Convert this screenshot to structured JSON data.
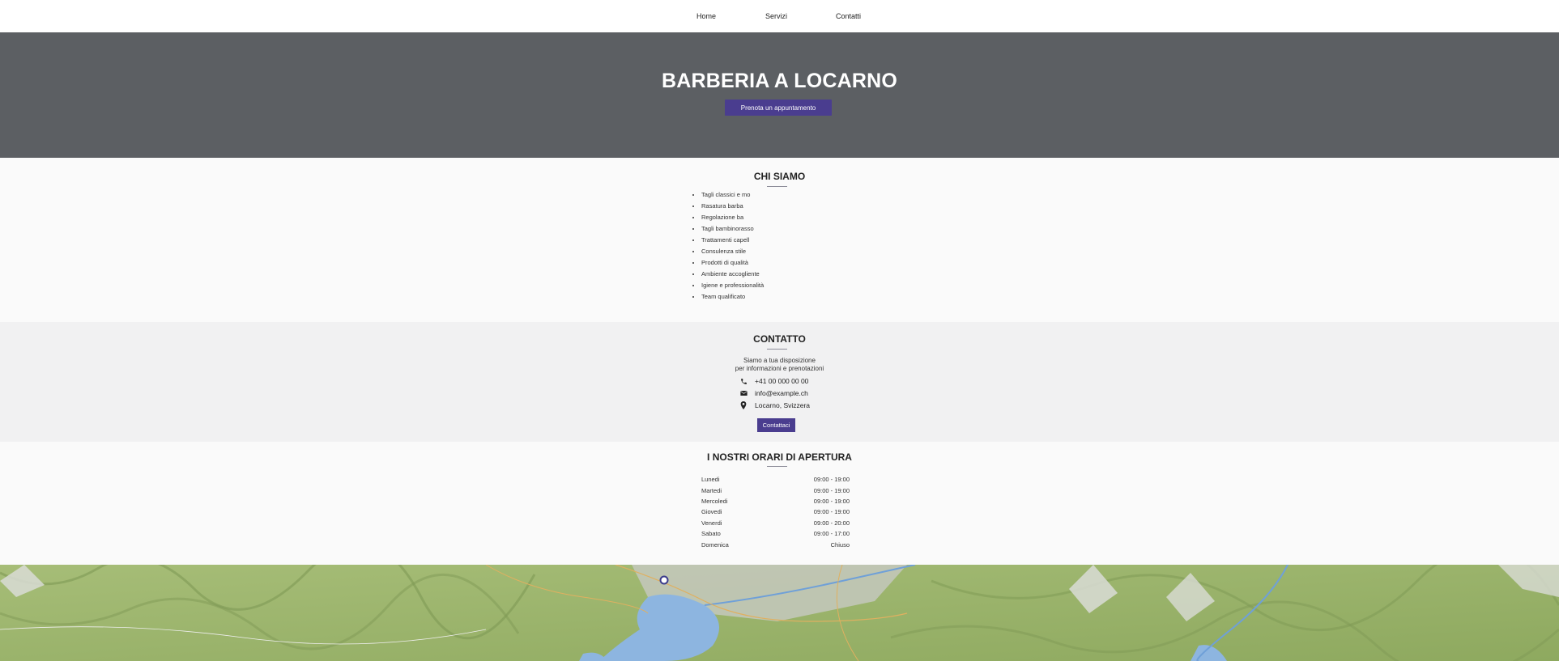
{
  "nav": {
    "items": [
      "Home",
      "Servizi",
      "Contatti"
    ]
  },
  "hero": {
    "title": "BARBERIA A LOCARNO",
    "cta_label": "Prenota un appuntamento"
  },
  "about": {
    "title": "CHI SIAMO",
    "items": [
      "Tagli classici e mo",
      "Rasatura barba",
      "Regolazione ba",
      "Tagli bambinorasso",
      "Trattamenti capell",
      "Consulenza stile",
      "Prodotti di qualità",
      "Ambiente accogliente",
      "Igiene e professionalità",
      "Team qualificato"
    ]
  },
  "contact": {
    "title": "CONTATTO",
    "intro_line1": "Siamo a tua disposizione",
    "intro_line2": "per informazioni e prenotazioni",
    "phone": "+41 00 000 00 00",
    "email": "info@example.ch",
    "location": "Locarno, Svizzera",
    "button_label": "Contattaci",
    "icons": [
      "phone-icon",
      "mail-icon",
      "map-pin-icon"
    ]
  },
  "hours": {
    "title": "I NOSTRI ORARI DI APERTURA",
    "rows": [
      {
        "day": "Lunedi",
        "time": "09:00 - 19:00"
      },
      {
        "day": "Martedi",
        "time": "09:00 - 19:00"
      },
      {
        "day": "Mercoledi",
        "time": "09:00 - 19:00"
      },
      {
        "day": "Giovedi",
        "time": "09:00 - 19:00"
      },
      {
        "day": "Venerdi",
        "time": "09:00 - 20:00"
      },
      {
        "day": "Sabato",
        "time": "09:00 - 17:00"
      },
      {
        "day": "Domenica",
        "time": "Chiuso"
      }
    ]
  },
  "colors": {
    "hero_bg": "#5c5f63",
    "accent": "#4a3d8f",
    "map_green": "#9bb56c",
    "lake_blue": "#8db5e0"
  }
}
